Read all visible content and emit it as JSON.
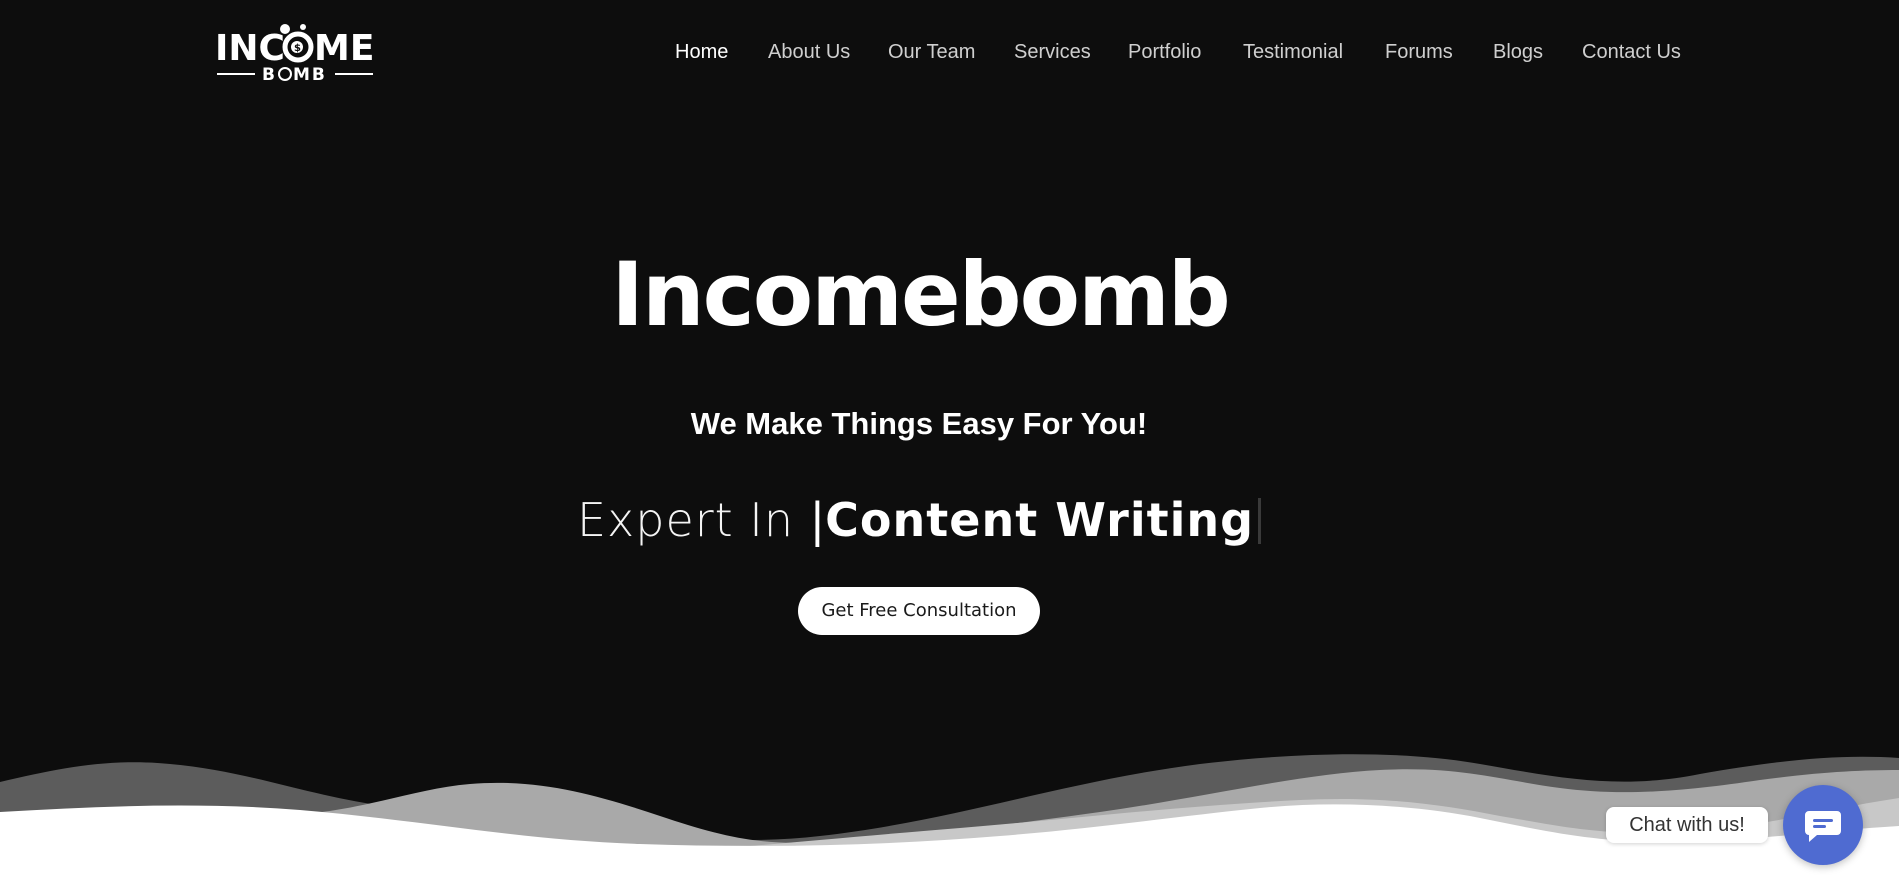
{
  "header": {
    "logo": {
      "brand_top": "INCOME",
      "brand_bottom": "BOMB"
    },
    "nav": [
      {
        "label": "Home",
        "active": true
      },
      {
        "label": "About Us",
        "active": false
      },
      {
        "label": "Our Team",
        "active": false
      },
      {
        "label": "Services",
        "active": false
      },
      {
        "label": "Portfolio",
        "active": false
      },
      {
        "label": "Testimonial",
        "active": false
      },
      {
        "label": "Forums",
        "active": false
      },
      {
        "label": "Blogs",
        "active": false
      },
      {
        "label": "Contact Us",
        "active": false
      }
    ]
  },
  "hero": {
    "title": "Incomebomb",
    "subtitle": "We Make Things Easy For You!",
    "expert_prefix": "Expert In ",
    "expert_bar": "|",
    "expert_word": "Content Writing",
    "cta_label": "Get Free Consultation"
  },
  "chat": {
    "label": "Chat with us!",
    "icon": "chat-bubble-icon"
  },
  "colors": {
    "hero_background": "#0d0d0d",
    "nav_text": "#cfcfcf",
    "nav_active": "#ffffff",
    "chat_accent": "#4f6bd1"
  }
}
